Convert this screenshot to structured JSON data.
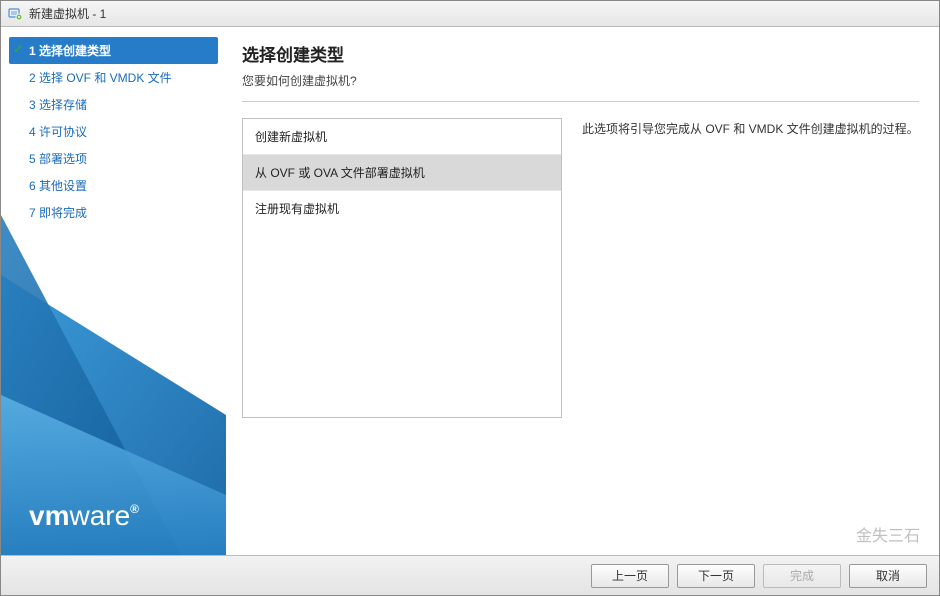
{
  "window": {
    "title": "新建虚拟机 - 1"
  },
  "sidebar": {
    "steps": [
      {
        "label": "1 选择创建类型",
        "active": true
      },
      {
        "label": "2 选择 OVF 和 VMDK 文件",
        "active": false
      },
      {
        "label": "3 选择存储",
        "active": false
      },
      {
        "label": "4 许可协议",
        "active": false
      },
      {
        "label": "5 部署选项",
        "active": false
      },
      {
        "label": "6 其他设置",
        "active": false
      },
      {
        "label": "7 即将完成",
        "active": false
      }
    ],
    "brand": "vmware"
  },
  "main": {
    "title": "选择创建类型",
    "subtitle": "您要如何创建虚拟机?",
    "options": [
      {
        "label": "创建新虚拟机",
        "selected": false
      },
      {
        "label": "从 OVF 或 OVA 文件部署虚拟机",
        "selected": true
      },
      {
        "label": "注册现有虚拟机",
        "selected": false
      }
    ],
    "description": "此选项将引导您完成从 OVF 和 VMDK 文件创建虚拟机的过程。"
  },
  "footer": {
    "back": "上一页",
    "next": "下一页",
    "finish": "完成",
    "cancel": "取消"
  },
  "watermark": "金失三石"
}
